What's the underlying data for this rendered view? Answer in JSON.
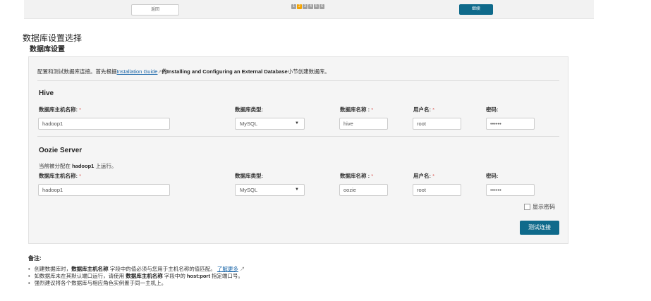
{
  "topbar": {
    "back_label": "返回",
    "steps": [
      "1",
      "2",
      "3",
      "4",
      "5",
      "6"
    ],
    "next_label": "继续"
  },
  "page_title": "数据库设置选择",
  "section_title": "数据库设置",
  "intro": {
    "prefix": "配置和测试数据库连接。首先根据",
    "link": "Installation Guide",
    "ext_icon": "↗",
    "bold": "的Installing and Configuring an External Database",
    "suffix": "小节创建数据库。"
  },
  "labels": {
    "host": "数据库主机名称:",
    "type": "数据库类型:",
    "dbname": "数据库名称 :",
    "user": "用户名:",
    "password": "密码:",
    "required_mark": "*"
  },
  "hive": {
    "title": "Hive",
    "host": "hadoop1",
    "type": "MySQL",
    "dbname": "hive",
    "user": "root",
    "password": "••••••"
  },
  "oozie": {
    "title": "Oozie Server",
    "running_prefix": "当前被分配在",
    "running_host": "hadoop1",
    "running_suffix": "上运行。",
    "host": "hadoop1",
    "type": "MySQL",
    "dbname": "oozie",
    "user": "root",
    "password": "••••••"
  },
  "show_password_label": "显示密码",
  "test_connection_label": "测试连接",
  "notes": {
    "title": "备注:",
    "n1_prefix": "创建数据库时，",
    "n1_bold": "数据库主机名称",
    "n1_mid": "字段中的值必须与您用于主机名称的值匹配。",
    "n1_link": "了解更多",
    "n2_prefix": "如数据库未在其默认端口运行，请使用",
    "n2_bold": "数据库主机名称",
    "n2_mid": "字段中的",
    "n2_bold2": "host:port",
    "n2_suffix": "指定端口号。",
    "n3": "强烈建议将各个数据库与相应角色实例置于同一主机上。"
  }
}
